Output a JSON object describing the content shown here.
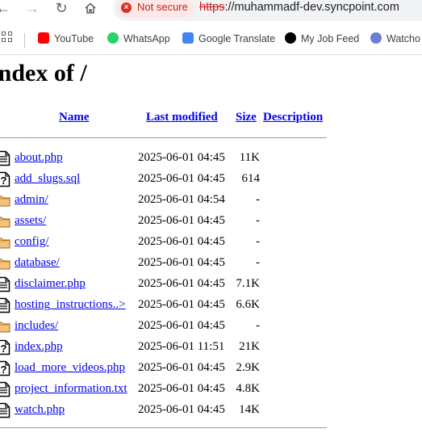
{
  "browser": {
    "security_label": "Not secure",
    "url_scheme": "https",
    "url_rest": "://muhammadf-dev.syncpoint.com",
    "bookmarks": [
      {
        "label": "YouTube",
        "icon": "youtube-icon"
      },
      {
        "label": "WhatsApp",
        "icon": "whatsapp-icon"
      },
      {
        "label": "Google Translate",
        "icon": "google-translate-icon"
      },
      {
        "label": "My Job Feed",
        "icon": "upwork-icon"
      },
      {
        "label": "Watcho",
        "icon": "play-icon"
      }
    ]
  },
  "page": {
    "title": "Index of /",
    "columns": {
      "name": "Name",
      "last_modified": "Last modified",
      "size": "Size",
      "description": "Description"
    },
    "files": [
      {
        "name": "about.php",
        "modified": "2025-06-01 04:45",
        "size": "11K",
        "type": "text"
      },
      {
        "name": "add_slugs.sql",
        "modified": "2025-06-01 04:45",
        "size": "614",
        "type": "unknown"
      },
      {
        "name": "admin/",
        "modified": "2025-06-01 04:54",
        "size": "-",
        "type": "folder"
      },
      {
        "name": "assets/",
        "modified": "2025-06-01 04:45",
        "size": "-",
        "type": "folder"
      },
      {
        "name": "config/",
        "modified": "2025-06-01 04:45",
        "size": "-",
        "type": "folder"
      },
      {
        "name": "database/",
        "modified": "2025-06-01 04:45",
        "size": "-",
        "type": "folder"
      },
      {
        "name": "disclaimer.php",
        "modified": "2025-06-01 04:45",
        "size": "7.1K",
        "type": "text"
      },
      {
        "name": "hosting_instructions..>",
        "modified": "2025-06-01 04:45",
        "size": "6.6K",
        "type": "text"
      },
      {
        "name": "includes/",
        "modified": "2025-06-01 04:45",
        "size": "-",
        "type": "folder"
      },
      {
        "name": "index.php",
        "modified": "2025-06-01 11:51",
        "size": "21K",
        "type": "unknown"
      },
      {
        "name": "load_more_videos.php",
        "modified": "2025-06-01 04:45",
        "size": "2.9K",
        "type": "unknown"
      },
      {
        "name": "project_information.txt",
        "modified": "2025-06-01 04:45",
        "size": "4.8K",
        "type": "text"
      },
      {
        "name": "watch.php",
        "modified": "2025-06-01 04:45",
        "size": "14K",
        "type": "text"
      }
    ]
  }
}
